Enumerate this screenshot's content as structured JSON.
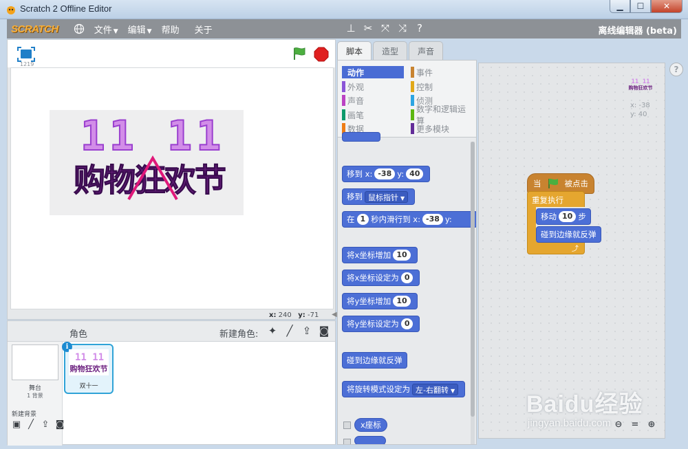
{
  "window": {
    "title": "Scratch 2 Offline Editor",
    "min_label": "▁",
    "max_label": "☐",
    "close_label": "✕"
  },
  "menubar": {
    "logo": "SCRATCH",
    "items": [
      {
        "label": "文件",
        "dropdown": true
      },
      {
        "label": "编辑",
        "dropdown": true
      },
      {
        "label": "帮助",
        "dropdown": false
      },
      {
        "label": "关于",
        "dropdown": false
      }
    ],
    "tools": [
      "duplicate-stamp-icon",
      "cut-icon",
      "grow-icon",
      "shrink-icon",
      "help-icon"
    ],
    "offline_label": "离线编辑器 (beta)"
  },
  "stage": {
    "version": "1219",
    "mouse_x_label": "x:",
    "mouse_x": "240",
    "mouse_y_label": "y:",
    "mouse_y": "-71",
    "banner_top": "11 11",
    "banner_bottom": "购物狂欢节"
  },
  "sprites": {
    "title": "角色",
    "new_sprite_label": "新建角色:",
    "stage_label": "舞台",
    "stage_sub": "1 背景",
    "new_bg_label": "新建背景",
    "sprite_name": "双十一"
  },
  "tabs": [
    "脚本",
    "造型",
    "声音"
  ],
  "categories": [
    {
      "label": "动作",
      "color": "#4a6cd4",
      "active": true
    },
    {
      "label": "外观",
      "color": "#8a55d7",
      "active": false
    },
    {
      "label": "声音",
      "color": "#bb42c3",
      "active": false
    },
    {
      "label": "画笔",
      "color": "#0e9a6c",
      "active": false
    },
    {
      "label": "数据",
      "color": "#ee7d16",
      "active": false
    },
    {
      "label": "事件",
      "color": "#c88330",
      "active": false
    },
    {
      "label": "控制",
      "color": "#e1a91a",
      "active": false
    },
    {
      "label": "侦测",
      "color": "#2ca5e2",
      "active": false
    },
    {
      "label": "数字和逻辑运算",
      "color": "#5cb712",
      "active": false
    },
    {
      "label": "更多模块",
      "color": "#632d99",
      "active": false
    }
  ],
  "palette_blocks": {
    "goto_xy": {
      "label": "移到 x:",
      "x": "-38",
      "ylabel": "y:",
      "y": "40"
    },
    "goto_target": {
      "label": "移到",
      "target": "鼠标指针"
    },
    "glide": {
      "label": "在",
      "secs": "1",
      "mid": "秒内滑行到 x:",
      "x": "-38",
      "ylabel": "y:"
    },
    "change_x": {
      "label": "将x坐标增加",
      "value": "10"
    },
    "set_x": {
      "label": "将x坐标设定为",
      "value": "0"
    },
    "change_y": {
      "label": "将y坐标增加",
      "value": "10"
    },
    "set_y": {
      "label": "将y坐标设定为",
      "value": "0"
    },
    "bounce": {
      "label": "碰到边缘就反弹"
    },
    "rotation_style": {
      "label": "将旋转模式设定为",
      "value": "左-右翻转"
    },
    "x_position": {
      "label": "x座标"
    }
  },
  "script": {
    "hat_when": "当",
    "hat_clicked": "被点击",
    "forever": "重复执行",
    "move_label": "移动",
    "move_steps": "10",
    "move_suffix": "步",
    "bounce": "碰到边缘就反弹",
    "sprite_x": "x: -38",
    "sprite_y": "y: 40"
  },
  "help_label": "?",
  "watermark": {
    "main": "Baidu经验",
    "sub": "jingyan.baidu.com"
  }
}
